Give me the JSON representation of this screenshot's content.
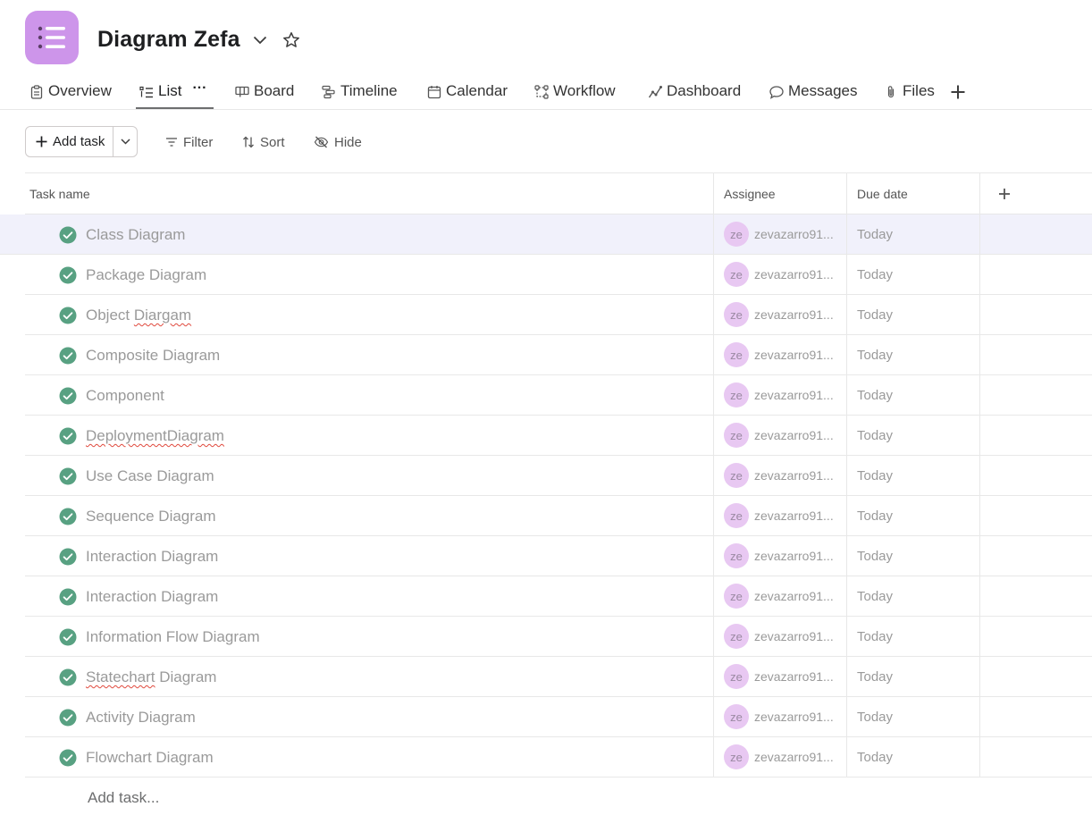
{
  "project": {
    "title": "Diagram Zefa",
    "icon": "list-icon",
    "icon_color": "#cd95ea"
  },
  "tabs": [
    {
      "label": "Overview",
      "icon": "clipboard-icon"
    },
    {
      "label": "List",
      "icon": "list-icon",
      "active": true
    },
    {
      "label": "Board",
      "icon": "board-icon"
    },
    {
      "label": "Timeline",
      "icon": "timeline-icon"
    },
    {
      "label": "Calendar",
      "icon": "calendar-icon"
    },
    {
      "label": "Workflow",
      "icon": "workflow-icon"
    },
    {
      "label": "Dashboard",
      "icon": "dashboard-icon"
    },
    {
      "label": "Messages",
      "icon": "message-icon"
    },
    {
      "label": "Files",
      "icon": "paperclip-icon"
    }
  ],
  "toolbar": {
    "add_task": "Add task",
    "filter": "Filter",
    "sort": "Sort",
    "hide": "Hide"
  },
  "columns": {
    "task": "Task name",
    "assignee": "Assignee",
    "due": "Due date"
  },
  "tasks": [
    {
      "name": "Class Diagram",
      "assignee_initials": "ze",
      "assignee": "zevazarro91...",
      "due": "Today"
    },
    {
      "name": "Package Diagram",
      "assignee_initials": "ze",
      "assignee": "zevazarro91...",
      "due": "Today"
    },
    {
      "name": "Object Diargam",
      "assignee_initials": "ze",
      "assignee": "zevazarro91...",
      "due": "Today"
    },
    {
      "name": "Composite Diagram",
      "assignee_initials": "ze",
      "assignee": "zevazarro91...",
      "due": "Today"
    },
    {
      "name": "Component",
      "assignee_initials": "ze",
      "assignee": "zevazarro91...",
      "due": "Today"
    },
    {
      "name": "DeploymentDiagram",
      "assignee_initials": "ze",
      "assignee": "zevazarro91...",
      "due": "Today"
    },
    {
      "name": "Use Case Diagram",
      "assignee_initials": "ze",
      "assignee": "zevazarro91...",
      "due": "Today"
    },
    {
      "name": "Sequence Diagram",
      "assignee_initials": "ze",
      "assignee": "zevazarro91...",
      "due": "Today"
    },
    {
      "name": "Interaction Diagram",
      "assignee_initials": "ze",
      "assignee": "zevazarro91...",
      "due": "Today"
    },
    {
      "name": "Interaction Diagram",
      "assignee_initials": "ze",
      "assignee": "zevazarro91...",
      "due": "Today"
    },
    {
      "name": "Information Flow Diagram",
      "assignee_initials": "ze",
      "assignee": "zevazarro91...",
      "due": "Today"
    },
    {
      "name": "Statechart Diagram",
      "assignee_initials": "ze",
      "assignee": "zevazarro91...",
      "due": "Today"
    },
    {
      "name": "Activity Diagram",
      "assignee_initials": "ze",
      "assignee": "zevazarro91...",
      "due": "Today"
    },
    {
      "name": "Flowchart Diagram",
      "assignee_initials": "ze",
      "assignee": "zevazarro91...",
      "due": "Today"
    }
  ],
  "add_task_row": "Add task...",
  "colors": {
    "check": "#58a182",
    "avatar_bg": "#e8c8f2",
    "hover_row": "#f1f1fb"
  }
}
